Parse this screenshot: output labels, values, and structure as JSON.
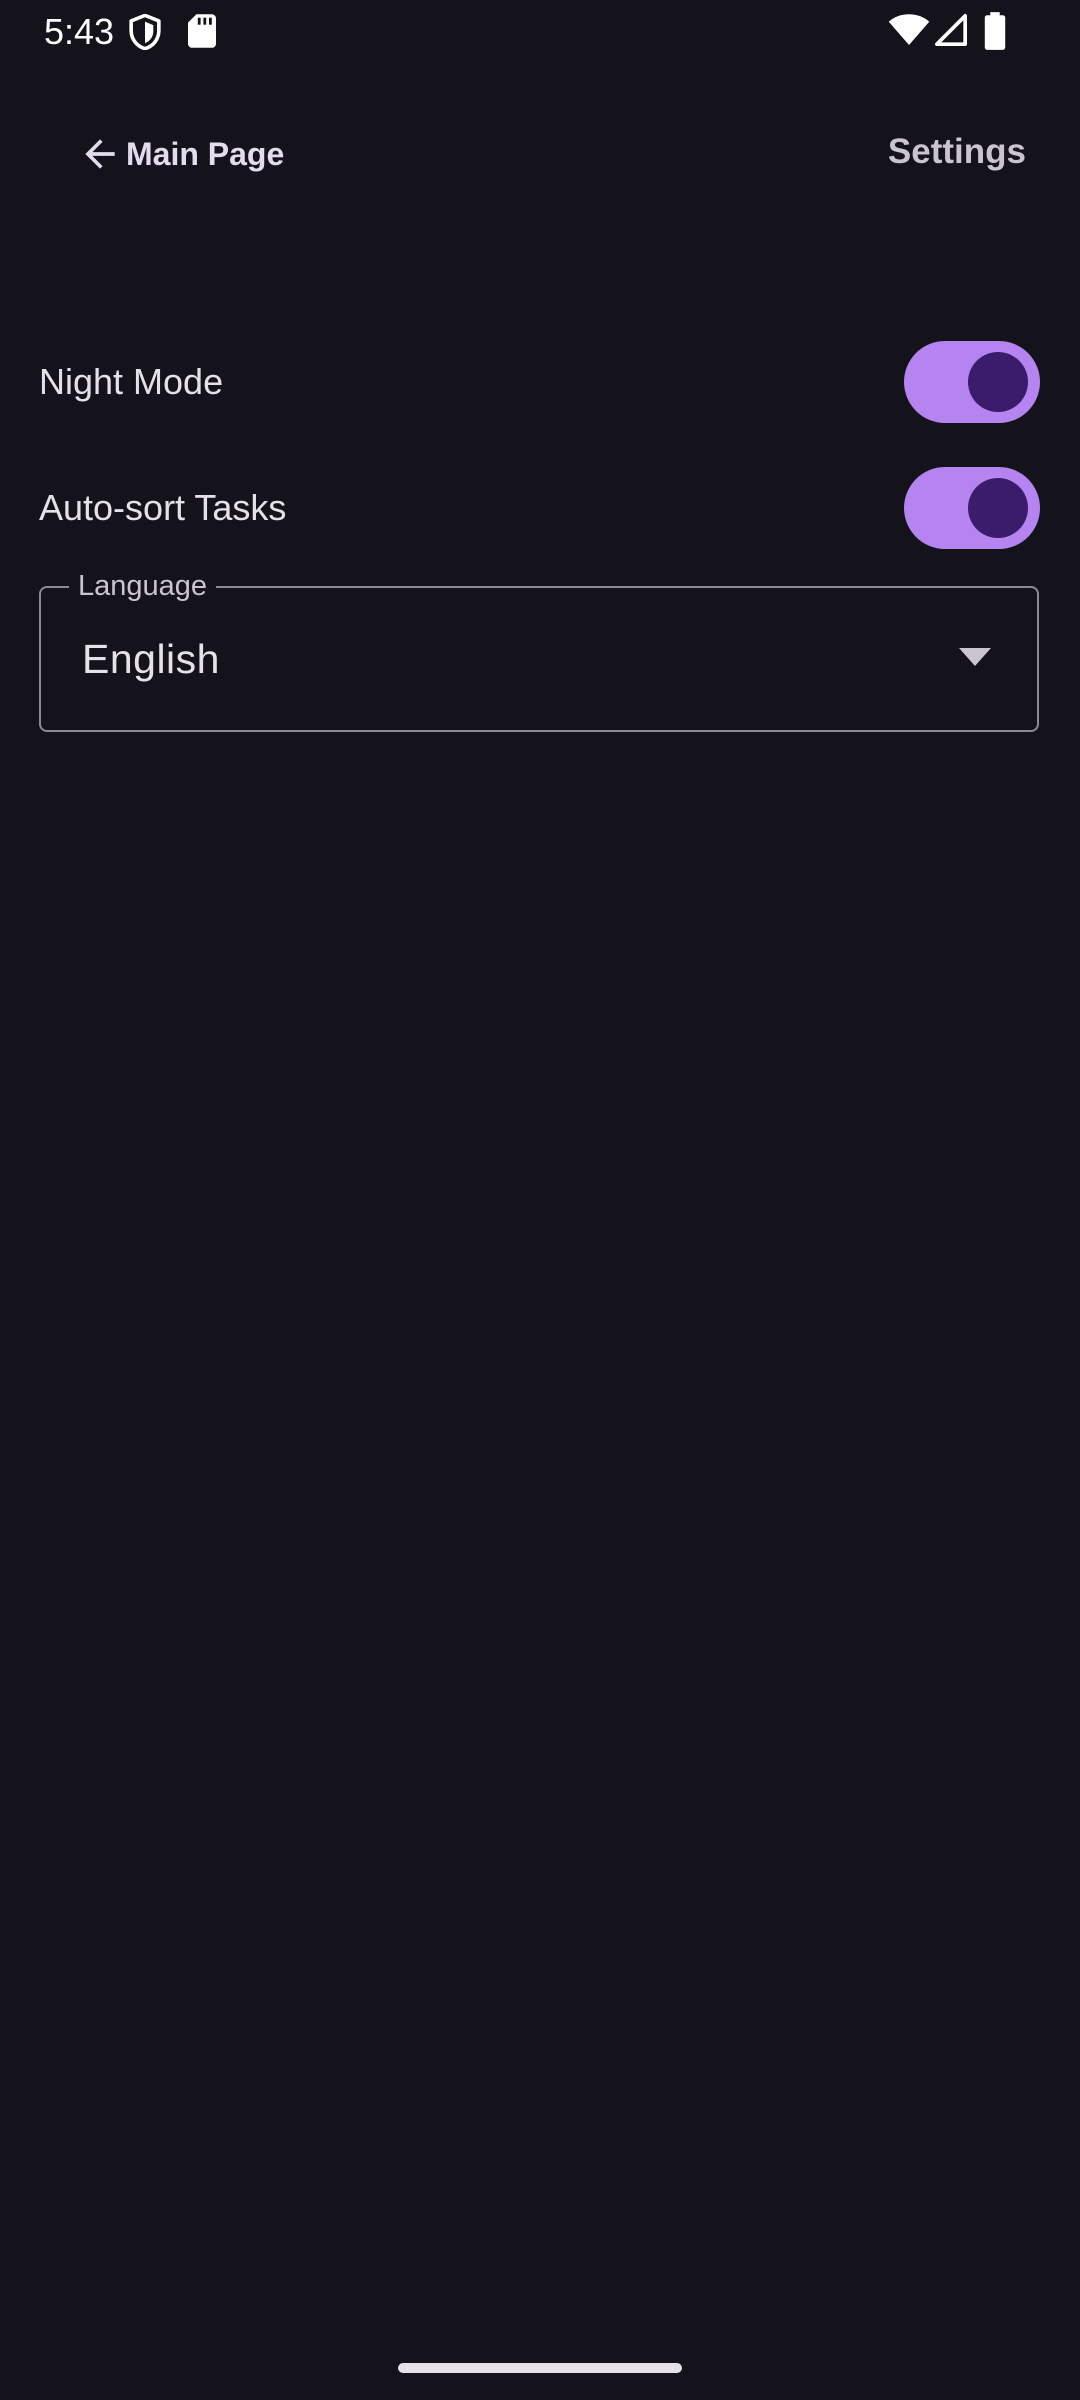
{
  "status_bar": {
    "time": "5:43",
    "icons": [
      "shield-icon",
      "sd-card-icon",
      "wifi-icon",
      "signal-icon",
      "battery-icon"
    ]
  },
  "top_bar": {
    "back_label": "Main Page",
    "title": "Settings"
  },
  "settings": {
    "night_mode": {
      "label": "Night Mode",
      "enabled": true
    },
    "auto_sort": {
      "label": "Auto-sort Tasks",
      "enabled": true
    },
    "language": {
      "label": "Language",
      "selected": "English"
    }
  },
  "colors": {
    "background": "#14121a",
    "switch_track": "#b584f0",
    "switch_thumb": "#3a1c6b",
    "outline": "#8e8896"
  }
}
